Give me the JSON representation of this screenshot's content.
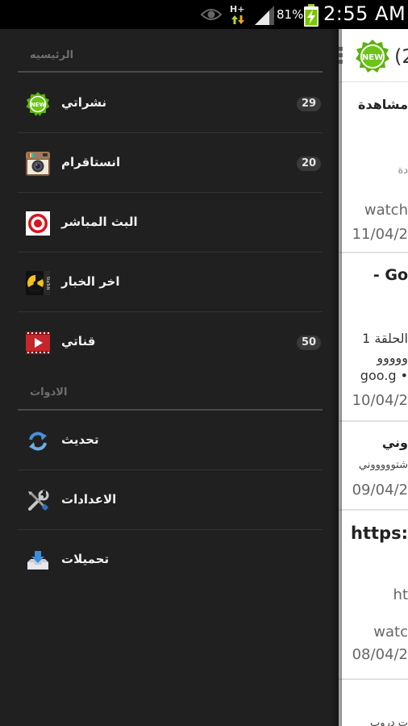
{
  "status_bar": {
    "network_type": "H+",
    "battery_percent": "81%",
    "time": "2:55 AM",
    "icons": [
      "eye-icon",
      "network-arrows-icon",
      "signal-icon",
      "battery-charging-icon"
    ]
  },
  "app_bar": {
    "badge_label": "NEW",
    "count_fragment": "(2"
  },
  "feed": [
    {
      "title": "مشاهدة",
      "line1": "دة",
      "line2": "watch",
      "date": "11/04/2"
    },
    {
      "title": "- Go",
      "line1": "الحلقة 1",
      "line2": "ووووو",
      "line3": "goo.g •",
      "date": "10/04/2"
    },
    {
      "title": "وني",
      "line1": "شتوووووني",
      "date": "09/04/2"
    },
    {
      "title": "https:",
      "line1": "ht",
      "line2": "watc",
      "date": "08/04/2"
    },
    {
      "title": "",
      "line1": "ت دروب"
    }
  ],
  "drawer": {
    "main_section_title": "الرئيسيه",
    "tools_section_title": "الادوات",
    "main_items": [
      {
        "label": "نشراتي",
        "count": "29",
        "icon": "new-badge-icon"
      },
      {
        "label": "انستاقرام",
        "count": "20",
        "icon": "instagram-icon"
      },
      {
        "label": "البث المباشر",
        "count": "",
        "icon": "live-target-icon"
      },
      {
        "label": "اخر الخبار",
        "count": "",
        "icon": "news-radiation-icon"
      },
      {
        "label": "قناتي",
        "count": "50",
        "icon": "youtube-icon"
      }
    ],
    "tool_items": [
      {
        "label": "تحديث",
        "icon": "refresh-icon"
      },
      {
        "label": "الاعدادات",
        "icon": "settings-tools-icon"
      },
      {
        "label": "تحميلات",
        "icon": "download-tray-icon"
      }
    ],
    "colors": {
      "drawer_background": "#202020",
      "badge_background": "#3a3a3a",
      "new_badge_green": "#5ab40a"
    }
  }
}
